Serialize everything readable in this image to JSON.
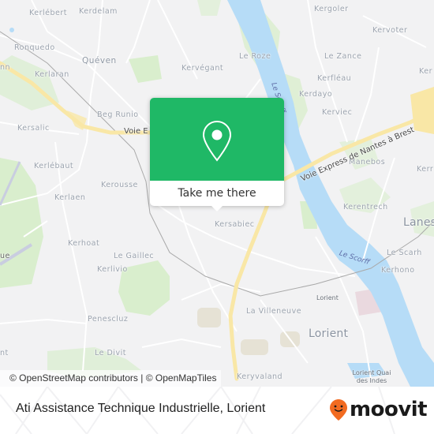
{
  "map": {
    "attribution": "© OpenStreetMap contributors | © OpenMapTiles",
    "colors": {
      "background": "#f2f2f3",
      "water": "#b6dcf7",
      "park": "#d8eecd",
      "motorway": "#f9e7a6",
      "road": "#ffffff",
      "railway": "#a8a8a8"
    },
    "places": [
      {
        "name": "Kerlébert",
        "type": "village"
      },
      {
        "name": "Kerdelam",
        "type": "village"
      },
      {
        "name": "Ronquedo",
        "type": "village"
      },
      {
        "name": "Quéven",
        "type": "town"
      },
      {
        "name": "Kerlaran",
        "type": "village"
      },
      {
        "name": "Beg Runio",
        "type": "village"
      },
      {
        "name": "Kersalic",
        "type": "village"
      },
      {
        "name": "Kerlébaut",
        "type": "village"
      },
      {
        "name": "Kerlaen",
        "type": "village"
      },
      {
        "name": "Kerousse",
        "type": "village"
      },
      {
        "name": "Kerhoat",
        "type": "village"
      },
      {
        "name": "Le Gaillec",
        "type": "village"
      },
      {
        "name": "Kerlivio",
        "type": "village"
      },
      {
        "name": "Penescluz",
        "type": "village"
      },
      {
        "name": "Le Divit",
        "type": "village"
      },
      {
        "name": "Kergoler",
        "type": "village"
      },
      {
        "name": "Kervoter",
        "type": "village"
      },
      {
        "name": "Le Roze",
        "type": "village"
      },
      {
        "name": "Le Zance",
        "type": "village"
      },
      {
        "name": "Kervégant",
        "type": "village"
      },
      {
        "name": "Kerfléau",
        "type": "village"
      },
      {
        "name": "Kerdayo",
        "type": "village"
      },
      {
        "name": "Kerviec",
        "type": "village"
      },
      {
        "name": "Manebos",
        "type": "village"
      },
      {
        "name": "Kerentrech",
        "type": "village"
      },
      {
        "name": "Lanes",
        "type": "city"
      },
      {
        "name": "Le Scarh",
        "type": "village"
      },
      {
        "name": "Kerhono",
        "type": "village"
      },
      {
        "name": "Kersabiec",
        "type": "village"
      },
      {
        "name": "La Villeneuve",
        "type": "village"
      },
      {
        "name": "Lorient",
        "type": "station"
      },
      {
        "name": "Lorient",
        "type": "city"
      },
      {
        "name": "Keryvaland",
        "type": "village"
      },
      {
        "name": "Lorient Quai des Indes",
        "type": "station"
      },
      {
        "name": "Kerr",
        "type": "village"
      },
      {
        "name": "Ker",
        "type": "village"
      },
      {
        "name": "nn",
        "type": "village"
      },
      {
        "name": "ue",
        "type": "village"
      },
      {
        "name": "nt",
        "type": "village"
      }
    ],
    "roads": [
      {
        "name": "Voie Express de Nantes à Brest"
      },
      {
        "name": "Voie E"
      }
    ],
    "waterways": [
      {
        "name": "Le Scorff"
      },
      {
        "name": "Le Scorff"
      }
    ]
  },
  "popup": {
    "icon": "map-pin-icon",
    "cta_label": "Take me there",
    "header_color": "#1fb866"
  },
  "footer": {
    "place_title": "Ati Assistance Technique Industrielle, Lorient",
    "brand": "moovit",
    "brand_color": "#f26b21"
  }
}
